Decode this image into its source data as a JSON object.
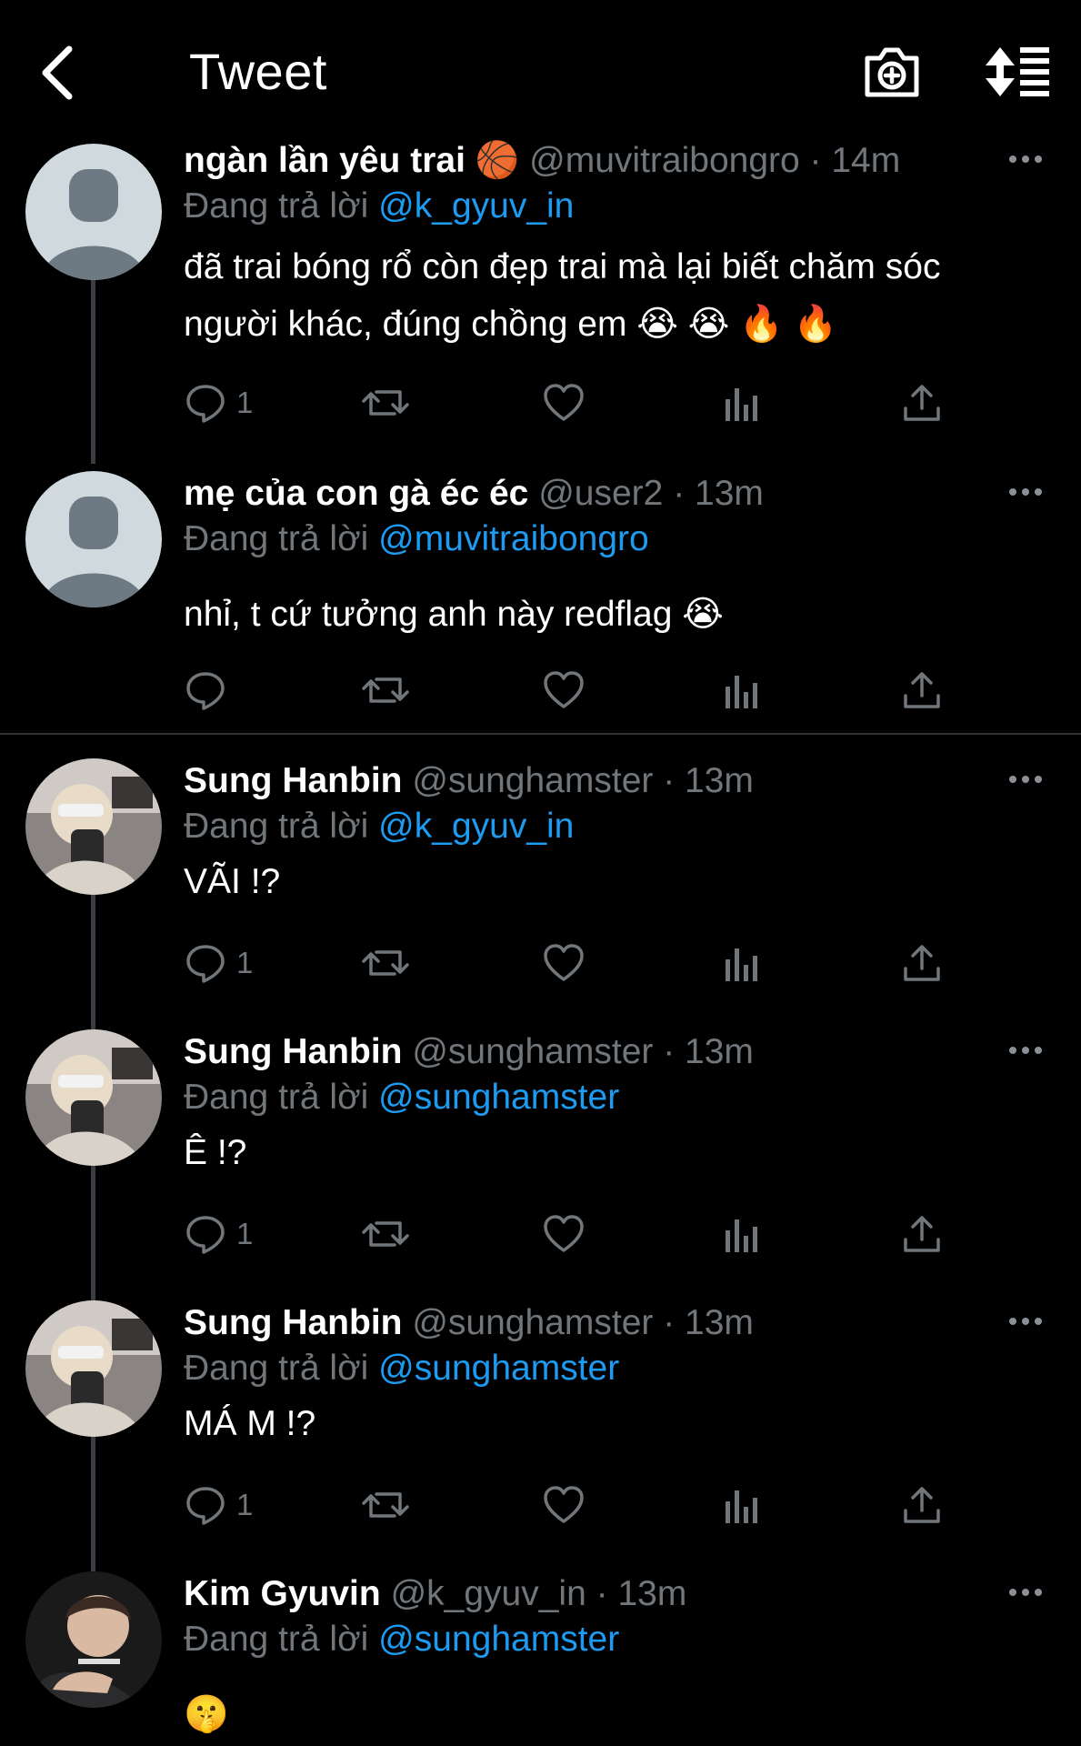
{
  "header": {
    "title": "Tweet",
    "back_icon": "back-arrow-icon",
    "camera_icon": "camera-plus-icon",
    "sort_icon": "sort-icon"
  },
  "tweets": [
    {
      "name": "ngàn lần yêu trai",
      "name_emoji": "🏀",
      "handle": "@muvitraibongro",
      "time": "· 14m",
      "reply_prefix": "Đang trả lời",
      "reply_to": "@k_gyuv_in",
      "text_line1": "đã trai bóng rổ còn đẹp trai mà lại biết chăm sóc",
      "text_line2": "người khác, đúng chồng em 😭 😭 🔥 🔥",
      "reply_count": "1"
    },
    {
      "name": "mẹ của con gà éc éc",
      "handle": "@user2",
      "time": "· 13m",
      "reply_prefix": "Đang trả lời",
      "reply_to": "@muvitraibongro",
      "text_line1": "nhỉ, t cứ tưởng anh này redflag 😭",
      "reply_count": ""
    },
    {
      "name": "Sung Hanbin",
      "handle": "@sunghamster",
      "time": "· 13m",
      "reply_prefix": "Đang trả lời",
      "reply_to": "@k_gyuv_in",
      "text_line1": "VÃI !?",
      "reply_count": "1"
    },
    {
      "name": "Sung Hanbin",
      "handle": "@sunghamster",
      "time": "· 13m",
      "reply_prefix": "Đang trả lời",
      "reply_to": "@sunghamster",
      "text_line1": "Ê !?",
      "reply_count": "1"
    },
    {
      "name": "Sung Hanbin",
      "handle": "@sunghamster",
      "time": "· 13m",
      "reply_prefix": "Đang trả lời",
      "reply_to": "@sunghamster",
      "text_line1": "MÁ M !?",
      "reply_count": "1"
    },
    {
      "name": "Kim Gyuvin",
      "handle": "@k_gyuv_in",
      "time": "· 13m",
      "reply_prefix": "Đang trả lời",
      "reply_to": "@sunghamster",
      "text_line1": "🤫"
    }
  ],
  "colors": {
    "background": "#000000",
    "text_primary": "#ffffff",
    "text_secondary": "#71767b",
    "link": "#1d9bf0",
    "divider": "#2f3336"
  }
}
